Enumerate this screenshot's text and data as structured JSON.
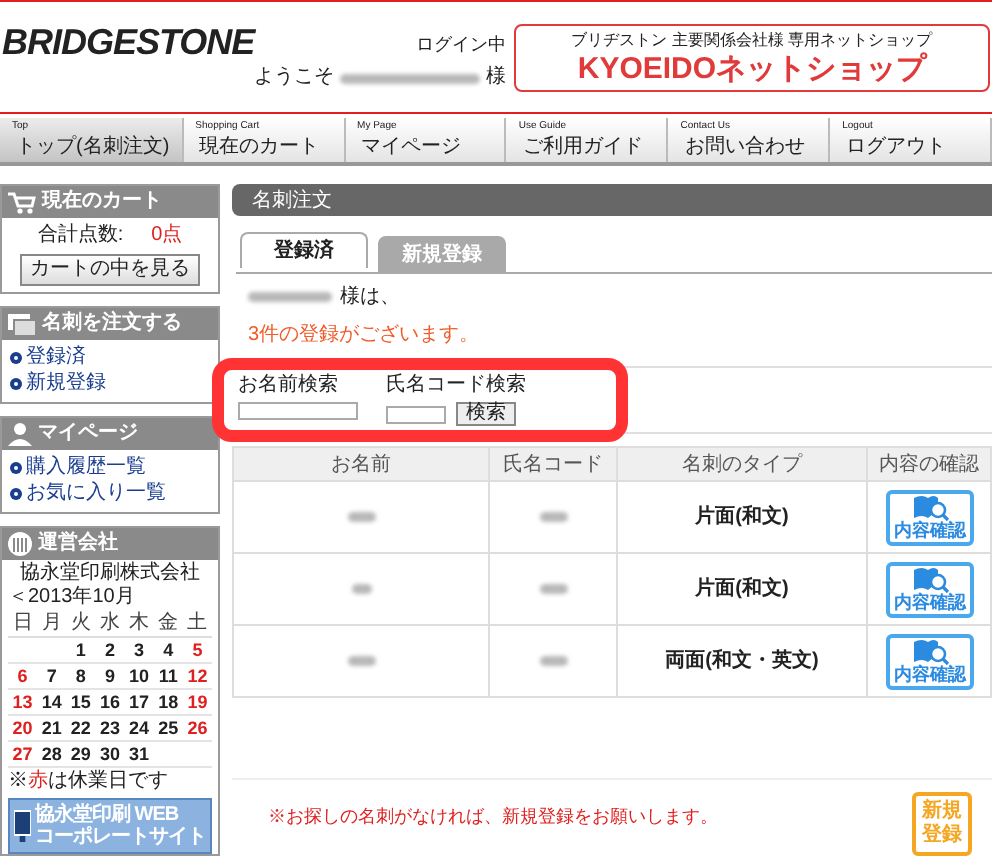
{
  "header": {
    "logo": "BRIDGESTONE",
    "login_status": "ログイン中",
    "welcome_prefix": "ようこそ",
    "welcome_suffix": "様",
    "banner": {
      "subtitle": "ブリヂストン 主要関係会社様 専用ネットショップ",
      "title": "KYOEIDOネットショップ"
    }
  },
  "nav": [
    {
      "en": "Top",
      "ja": "トップ(名刺注文)",
      "selected": true
    },
    {
      "en": "Shopping Cart",
      "ja": "現在のカート",
      "selected": false
    },
    {
      "en": "My Page",
      "ja": "マイページ",
      "selected": false
    },
    {
      "en": "Use Guide",
      "ja": "ご利用ガイド",
      "selected": false
    },
    {
      "en": "Contact Us",
      "ja": "お問い合わせ",
      "selected": false
    },
    {
      "en": "Logout",
      "ja": "ログアウト",
      "selected": false
    }
  ],
  "sidebar": {
    "cart": {
      "title": "現在のカート",
      "total_label": "合計点数:",
      "total_value": "0点",
      "button": "カートの中を見る"
    },
    "order": {
      "title": "名刺を注文する",
      "links": [
        "登録済",
        "新規登録"
      ]
    },
    "mypage": {
      "title": "マイページ",
      "links": [
        "購入履歴一覧",
        "お気に入り一覧"
      ]
    },
    "company": {
      "title": "運営会社",
      "name": "協永堂印刷株式会社",
      "month": "＜2013年10月",
      "weekdays": [
        "日",
        "月",
        "火",
        "水",
        "木",
        "金",
        "土"
      ],
      "weeks": [
        [
          {
            "day": "1",
            "holiday": false
          },
          {
            "day": "2",
            "holiday": false
          },
          {
            "day": "3",
            "holiday": false
          },
          {
            "day": "4",
            "holiday": false
          },
          {
            "day": "5",
            "holiday": true
          }
        ],
        [
          {
            "day": "6",
            "holiday": true
          },
          {
            "day": "7",
            "holiday": false
          },
          {
            "day": "8",
            "holiday": false
          },
          {
            "day": "9",
            "holiday": false
          },
          {
            "day": "10",
            "holiday": false
          },
          {
            "day": "11",
            "holiday": false
          },
          {
            "day": "12",
            "holiday": true
          }
        ],
        [
          {
            "day": "13",
            "holiday": true
          },
          {
            "day": "14",
            "holiday": false
          },
          {
            "day": "15",
            "holiday": false
          },
          {
            "day": "16",
            "holiday": false
          },
          {
            "day": "17",
            "holiday": false
          },
          {
            "day": "18",
            "holiday": false
          },
          {
            "day": "19",
            "holiday": true
          }
        ],
        [
          {
            "day": "20",
            "holiday": true
          },
          {
            "day": "21",
            "holiday": false
          },
          {
            "day": "22",
            "holiday": false
          },
          {
            "day": "23",
            "holiday": false
          },
          {
            "day": "24",
            "holiday": false
          },
          {
            "day": "25",
            "holiday": false
          },
          {
            "day": "26",
            "holiday": true
          }
        ],
        [
          {
            "day": "27",
            "holiday": true
          },
          {
            "day": "28",
            "holiday": false
          },
          {
            "day": "29",
            "holiday": false
          },
          {
            "day": "30",
            "holiday": false
          },
          {
            "day": "31",
            "holiday": false
          }
        ]
      ],
      "note_prefix": "※",
      "note_highlight": "赤",
      "note_suffix": "は休業日です",
      "banner_lines": [
        "協永堂印刷 WEB",
        "コーポレートサイト"
      ]
    }
  },
  "content": {
    "title": "名刺注文",
    "tabs": [
      {
        "label": "登録済",
        "selected": true
      },
      {
        "label": "新規登録",
        "selected": false
      }
    ],
    "greeting": "様は、",
    "count_message": "3件の登録がございます。",
    "search": {
      "fields": [
        {
          "label": "お名前検索"
        },
        {
          "label": "氏名コード検索"
        }
      ],
      "button": "検索"
    },
    "table": {
      "columns": [
        "お名前",
        "氏名コード",
        "名刺のタイプ",
        "内容の確認"
      ],
      "rows": [
        {
          "type": "片面(和文)",
          "action": "内容確認"
        },
        {
          "type": "片面(和文)",
          "action": "内容確認"
        },
        {
          "type": "両面(和文・英文)",
          "action": "内容確認"
        }
      ]
    },
    "note": "※お探しの名刺がなければ、新規登録をお願いします。",
    "new_button": [
      "新規",
      "登録"
    ]
  }
}
